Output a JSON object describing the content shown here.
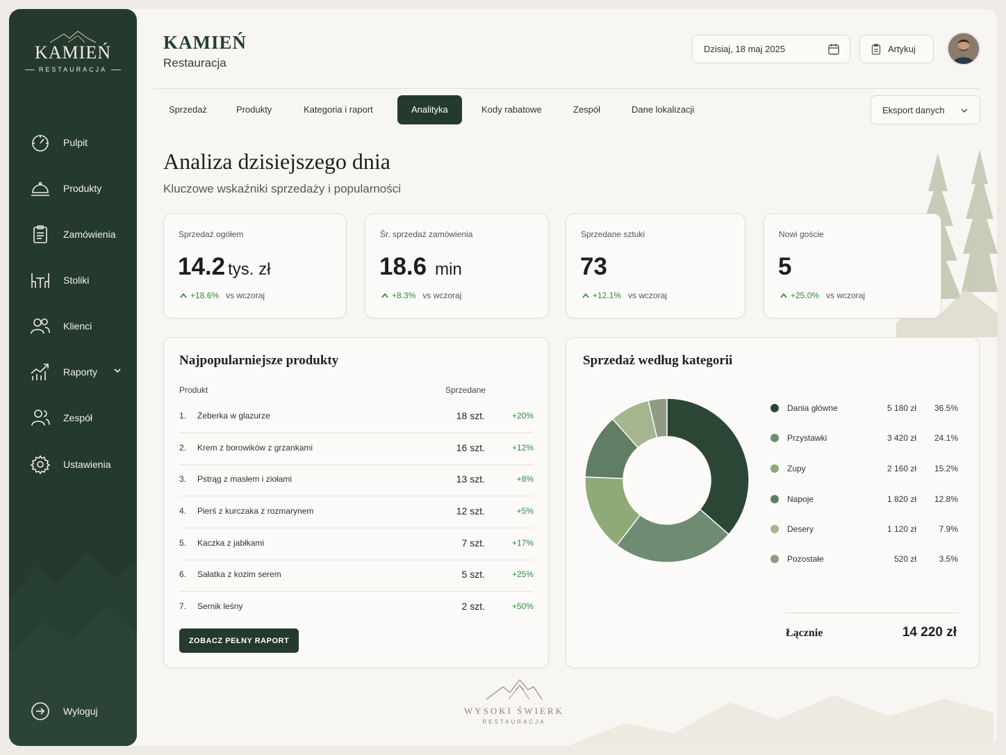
{
  "brand": {
    "name": "KAMIEŃ",
    "subtitle": "RESTAURACJA"
  },
  "header": {
    "title": "KAMIEŃ",
    "subtitle": "Restauracja",
    "date": "Dzisiaj, 18 maj 2025",
    "print_label": "Artykuj"
  },
  "sidebar": {
    "items": [
      {
        "label": "Pulpit",
        "icon": "gauge-icon"
      },
      {
        "label": "Produkty",
        "icon": "cloche-icon"
      },
      {
        "label": "Zamówienia",
        "icon": "clipboard-icon"
      },
      {
        "label": "Stoliki",
        "icon": "table-chairs-icon"
      },
      {
        "label": "Klienci",
        "icon": "users-icon"
      },
      {
        "label": "Raporty",
        "icon": "chart-icon"
      },
      {
        "label": "Zespół",
        "icon": "team-icon"
      },
      {
        "label": "Ustawienia",
        "icon": "gear-icon"
      }
    ],
    "logout": "Wyloguj"
  },
  "tabs": [
    {
      "label": "Sprzedaż"
    },
    {
      "label": "Produkty"
    },
    {
      "label": "Kategoria i raport"
    },
    {
      "label": "Analityka",
      "active": true
    },
    {
      "label": "Kody rabatowe"
    },
    {
      "label": "Zespół"
    },
    {
      "label": "Dane lokalizacji"
    }
  ],
  "export_label": "Eksport danych",
  "page": {
    "title": "Analiza dzisiejszego dnia",
    "subtitle": "Kluczowe wskaźniki sprzedaży i popularności"
  },
  "kpis": [
    {
      "label": "Sprzedaż ogółem",
      "value": "14.2",
      "unit": "tys. zł",
      "change": "+18.6%",
      "vs": "vs wczoraj"
    },
    {
      "label": "Śr. sprzedaż zamówienia",
      "value": "18.6",
      "unit": "min",
      "change": "+8.3%",
      "vs": "vs wczoraj"
    },
    {
      "label": "Sprzedane sztuki",
      "value": "73",
      "unit": "",
      "change": "+12.1%",
      "vs": "vs wczoraj"
    },
    {
      "label": "Nowi goście",
      "value": "5",
      "unit": "",
      "change": "+25.0%",
      "vs": "vs wczoraj"
    }
  ],
  "products": {
    "title": "Najpopularniejsze produkty",
    "col_product": "Produkt",
    "col_sold": "Sprzedane",
    "rows": [
      {
        "num": "1.",
        "name": "Żeberka w glazurze",
        "qty": "18 szt.",
        "pct": "+20%"
      },
      {
        "num": "2.",
        "name": "Krem z borowików z grzankami",
        "qty": "16 szt.",
        "pct": "+12%"
      },
      {
        "num": "3.",
        "name": "Pstrąg z masłem i ziołami",
        "qty": "13 szt.",
        "pct": "+8%"
      },
      {
        "num": "4.",
        "name": "Pierś z kurczaka z rozmarynem",
        "qty": "12 szt.",
        "pct": "+5%"
      },
      {
        "num": "5.",
        "name": "Kaczka z jabłkami",
        "qty": "7 szt.",
        "pct": "+17%"
      },
      {
        "num": "6.",
        "name": "Sałatka z kozim serem",
        "qty": "5 szt.",
        "pct": "+25%"
      },
      {
        "num": "7.",
        "name": "Sernik leśny",
        "qty": "2 szt.",
        "pct": "+50%"
      }
    ],
    "button": "ZOBACZ PEŁNY RAPORT"
  },
  "categories": {
    "title": "Sprzedaż według kategorii",
    "total_label": "Łącznie",
    "total_value": "14 220 zł"
  },
  "chart_data": {
    "type": "pie",
    "title": "Sprzedaż według kategorii",
    "categories": [
      "Dania główne",
      "Przystawki",
      "Zupy",
      "Napoje",
      "Desery",
      "Pozostałe"
    ],
    "values": [
      5180,
      3420,
      2160,
      1820,
      1120,
      520
    ],
    "amount_labels": [
      "5 180 zł",
      "3 420 zł",
      "2 160 zł",
      "1 820 zł",
      "1 120 zł",
      "520 zł"
    ],
    "percent_labels": [
      "36.5%",
      "24.1%",
      "15.2%",
      "12.8%",
      "7.9%",
      "3.5%"
    ],
    "colors": [
      "#2b4634",
      "#6f8c72",
      "#8fa977",
      "#5f7e64",
      "#a4b58f",
      "#8e9c83"
    ],
    "legend_position": "right"
  },
  "footer": {
    "name": "WYSOKI ŚWIERK",
    "subtitle": "RESTAURACJA"
  },
  "colors": {
    "primary": "#243a2e",
    "positive": "#2f8a3d",
    "background": "#f8f6f2"
  }
}
